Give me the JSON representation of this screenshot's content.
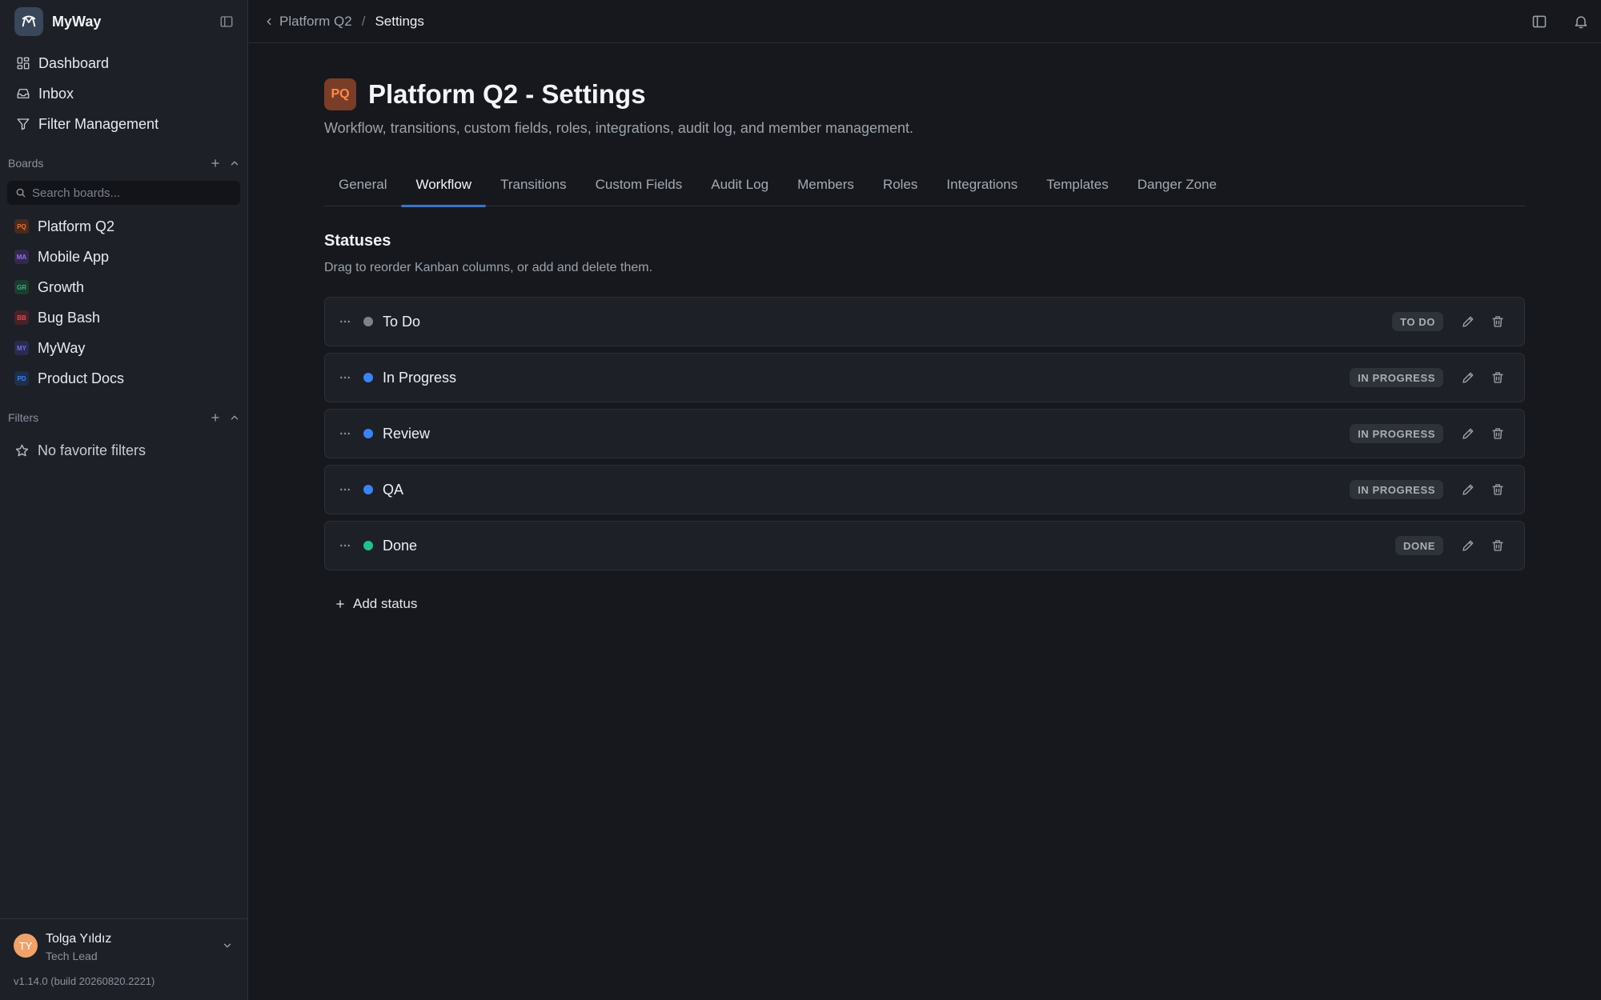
{
  "app": {
    "name": "MyWay"
  },
  "sidebar": {
    "nav": [
      {
        "label": "Dashboard",
        "icon": "grid-icon"
      },
      {
        "label": "Inbox",
        "icon": "inbox-icon"
      },
      {
        "label": "Filter Management",
        "icon": "filter-icon"
      }
    ],
    "boards_label": "Boards",
    "search_placeholder": "Search boards...",
    "boards": [
      {
        "abbr": "PQ",
        "label": "Platform Q2",
        "color": "#e8743b",
        "bg": "#4a2a1f"
      },
      {
        "abbr": "MA",
        "label": "Mobile App",
        "color": "#9b6cf0",
        "bg": "#33294d"
      },
      {
        "abbr": "GR",
        "label": "Growth",
        "color": "#2fb880",
        "bg": "#1d3b30"
      },
      {
        "abbr": "BB",
        "label": "Bug Bash",
        "color": "#e5484d",
        "bg": "#472226"
      },
      {
        "abbr": "MY",
        "label": "MyWay",
        "color": "#6e6cf0",
        "bg": "#2b2b4d"
      },
      {
        "abbr": "PD",
        "label": "Product Docs",
        "color": "#3b82f6",
        "bg": "#1f2f4a"
      }
    ],
    "filters_label": "Filters",
    "no_filters": "No favorite filters"
  },
  "user": {
    "initials": "TY",
    "name": "Tolga Yıldız",
    "role": "Tech Lead",
    "version": "v1.14.0 (build 20260820.2221)"
  },
  "breadcrumb": {
    "parent": "Platform Q2",
    "separator": "/",
    "current": "Settings"
  },
  "page": {
    "badge": "PQ",
    "title": "Platform Q2 - Settings",
    "subtitle": "Workflow, transitions, custom fields, roles, integrations, audit log, and member management."
  },
  "tabs": [
    {
      "label": "General",
      "active": false
    },
    {
      "label": "Workflow",
      "active": true
    },
    {
      "label": "Transitions",
      "active": false
    },
    {
      "label": "Custom Fields",
      "active": false
    },
    {
      "label": "Audit Log",
      "active": false
    },
    {
      "label": "Members",
      "active": false
    },
    {
      "label": "Roles",
      "active": false
    },
    {
      "label": "Integrations",
      "active": false
    },
    {
      "label": "Templates",
      "active": false
    },
    {
      "label": "Danger Zone",
      "active": false
    }
  ],
  "statuses_section": {
    "title": "Statuses",
    "description": "Drag to reorder Kanban columns, or add and delete them.",
    "items": [
      {
        "name": "To Do",
        "category": "TO DO",
        "dot": "#7d828b"
      },
      {
        "name": "In Progress",
        "category": "IN PROGRESS",
        "dot": "#3b82f6"
      },
      {
        "name": "Review",
        "category": "IN PROGRESS",
        "dot": "#3b82f6"
      },
      {
        "name": "QA",
        "category": "IN PROGRESS",
        "dot": "#3b82f6"
      },
      {
        "name": "Done",
        "category": "DONE",
        "dot": "#22c08a"
      }
    ],
    "add_label": "Add status"
  }
}
